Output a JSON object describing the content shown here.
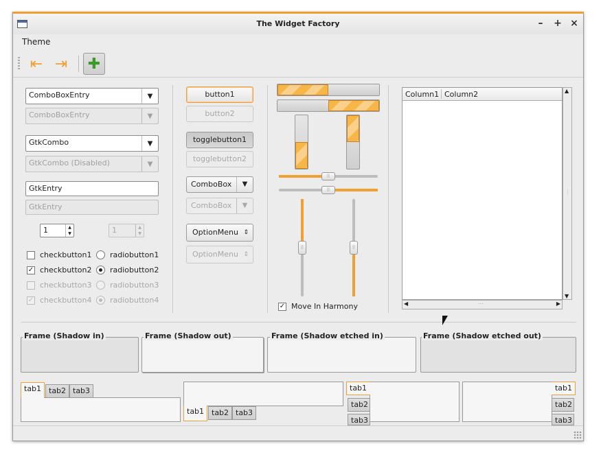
{
  "window": {
    "title": "The Widget Factory",
    "minimize": "–",
    "maximize": "+",
    "close": "×"
  },
  "menubar": {
    "theme": "Theme"
  },
  "colors": {
    "accent": "#f0a030"
  },
  "col1": {
    "combo_entry": "ComboBoxEntry",
    "combo_entry_disabled": "ComboBoxEntry",
    "gtk_combo": "GtkCombo",
    "gtk_combo_disabled": "GtkCombo (Disabled)",
    "gtk_entry": "GtkEntry",
    "gtk_entry_placeholder": "GtkEntry",
    "spin1": "1",
    "spin2": "1",
    "checkbutton1": "checkbutton1",
    "checkbutton2": "checkbutton2",
    "checkbutton3": "checkbutton3",
    "checkbutton4": "checkbutton4",
    "radiobutton1": "radiobutton1",
    "radiobutton2": "radiobutton2",
    "radiobutton3": "radiobutton3",
    "radiobutton4": "radiobutton4"
  },
  "col2": {
    "button1": "button1",
    "button2": "button2",
    "togglebutton1": "togglebutton1",
    "togglebutton2": "togglebutton2",
    "combobox": "ComboBox",
    "combobox_disabled": "ComboBox",
    "optionmenu": "OptionMenu",
    "optionmenu_disabled": "OptionMenu"
  },
  "col3": {
    "progress_h1": 0.5,
    "progress_h2": 0.5,
    "progress_v1": 0.5,
    "progress_v2": 0.5,
    "slider_h1": 0.5,
    "slider_h2": 0.5,
    "slider_v1": 0.5,
    "slider_v2": 0.5,
    "move_in_harmony": "Move In Harmony"
  },
  "tree": {
    "columns": [
      "Column1",
      "Column2"
    ]
  },
  "frames": {
    "shadow_in": "Frame (Shadow in)",
    "shadow_out": "Frame (Shadow out)",
    "shadow_etched_in": "Frame (Shadow etched in)",
    "shadow_etched_out": "Frame (Shadow etched out)"
  },
  "notebooks": {
    "top": [
      "tab1",
      "tab2",
      "tab3"
    ],
    "bottom": [
      "tab1",
      "tab2",
      "tab3"
    ],
    "left": [
      "tab1",
      "tab2",
      "tab3"
    ],
    "right": [
      "tab1",
      "tab2",
      "tab3"
    ]
  }
}
